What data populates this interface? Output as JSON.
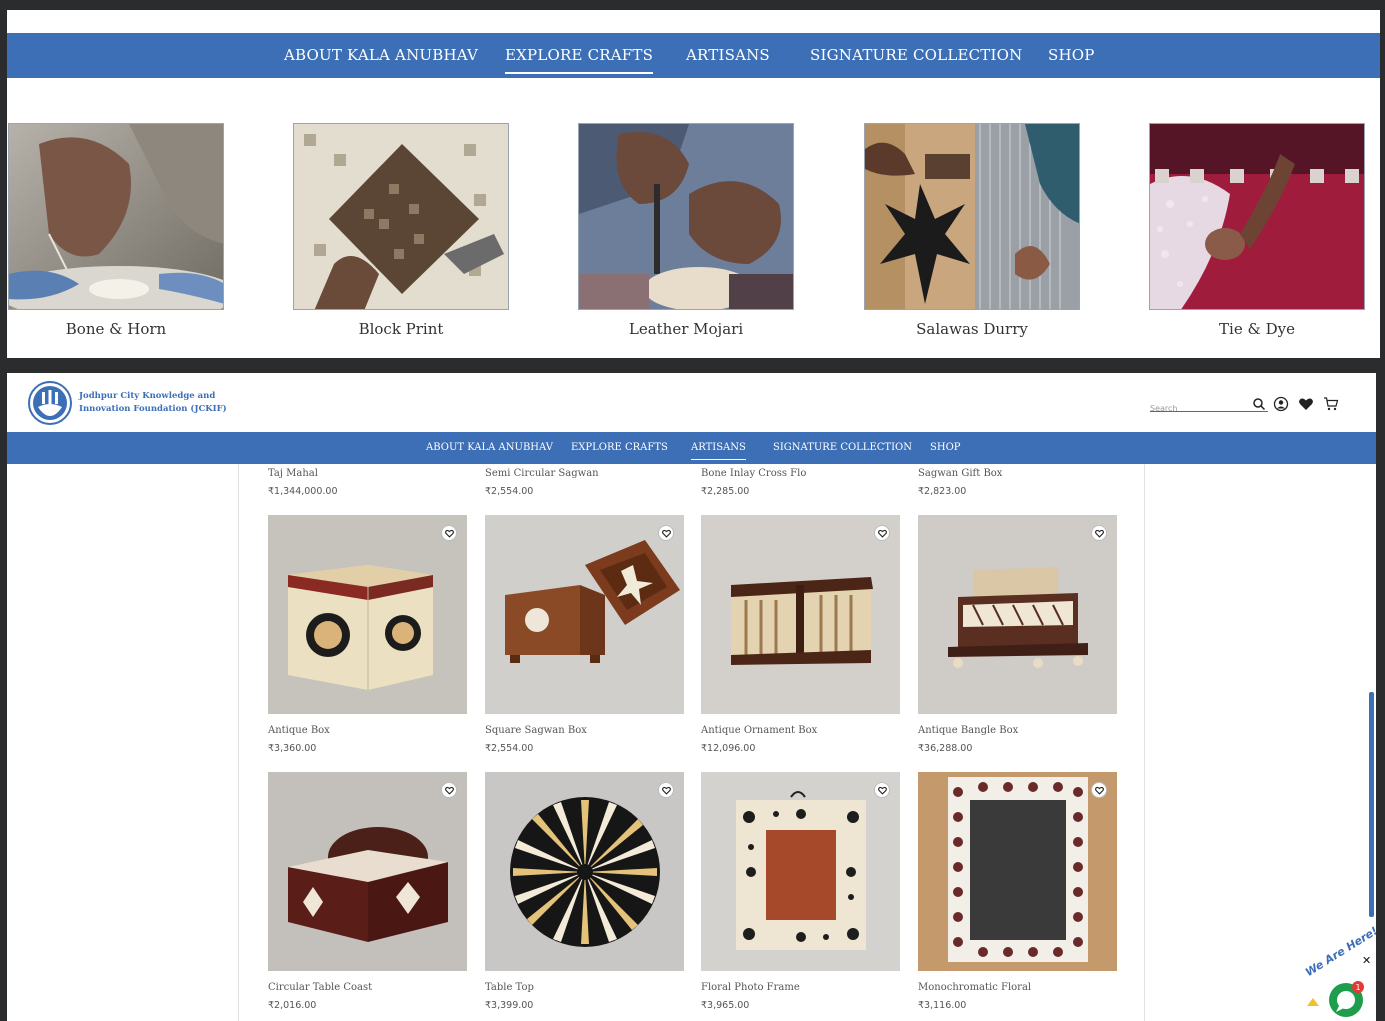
{
  "top_panel": {
    "nav": [
      {
        "label": "ABOUT KALA ANUBHAV"
      },
      {
        "label": "EXPLORE CRAFTS"
      },
      {
        "label": "ARTISANS"
      },
      {
        "label": "SIGNATURE COLLECTION"
      },
      {
        "label": "SHOP"
      }
    ],
    "active_nav": "EXPLORE CRAFTS",
    "crafts": [
      {
        "label": "Bone & Horn"
      },
      {
        "label": "Block Print"
      },
      {
        "label": "Leather Mojari"
      },
      {
        "label": "Salawas Durry"
      },
      {
        "label": "Tie & Dye"
      }
    ]
  },
  "header": {
    "logo_text": "Jodhpur City Knowledge and Innovation Foundation (JCKIF)",
    "search_placeholder": "Search",
    "icons": [
      "search-icon",
      "account-icon",
      "wishlist-heart-icon",
      "cart-icon"
    ]
  },
  "bottom_nav": [
    {
      "label": "ABOUT KALA ANUBHAV"
    },
    {
      "label": "EXPLORE CRAFTS"
    },
    {
      "label": "ARTISANS"
    },
    {
      "label": "SIGNATURE COLLECTION"
    },
    {
      "label": "SHOP"
    }
  ],
  "bottom_active_nav": "ARTISANS",
  "products_row0": [
    {
      "name": "Taj Mahal",
      "price": "₹1,344,000.00"
    },
    {
      "name": "Semi Circular Sagwan",
      "price": "₹2,554.00"
    },
    {
      "name": "Bone Inlay Cross Flo",
      "price": "₹2,285.00"
    },
    {
      "name": "Sagwan Gift Box",
      "price": "₹2,823.00"
    }
  ],
  "products_row1": [
    {
      "name": "Antique Box",
      "price": "₹3,360.00"
    },
    {
      "name": "Square Sagwan Box",
      "price": "₹2,554.00"
    },
    {
      "name": "Antique Ornament Box",
      "price": "₹12,096.00"
    },
    {
      "name": "Antique Bangle Box",
      "price": "₹36,288.00"
    }
  ],
  "products_row2": [
    {
      "name": "Circular Table Coast",
      "price": "₹2,016.00"
    },
    {
      "name": "Table Top",
      "price": "₹3,399.00"
    },
    {
      "name": "Floral Photo Frame",
      "price": "₹3,965.00"
    },
    {
      "name": "Monochromatic Floral",
      "price": "₹3,116.00"
    }
  ],
  "chat_widget": {
    "label": "We Are Here!",
    "badge": "1"
  },
  "colors": {
    "brand_blue": "#3d6fb6",
    "background": "#2b2c2e"
  }
}
